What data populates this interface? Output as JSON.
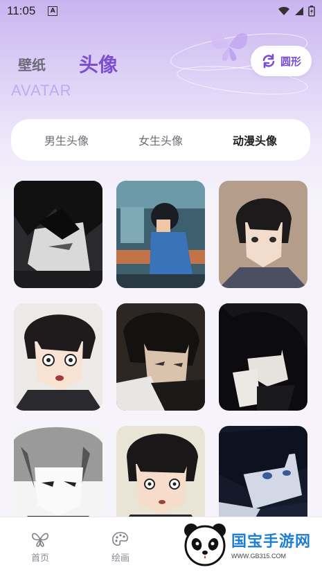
{
  "status_bar": {
    "time": "11:05",
    "notification_letter": "A"
  },
  "header": {
    "tab_wallpaper": "壁纸",
    "tab_avatar": "头像",
    "subtitle": "AVATAR",
    "shape_button_label": "圆形"
  },
  "categories": [
    {
      "label": "男生头像",
      "active": false
    },
    {
      "label": "女生头像",
      "active": false
    },
    {
      "label": "动漫头像",
      "active": true
    }
  ],
  "avatars": [
    {
      "icon": "anime-avatar-dark-glasses"
    },
    {
      "icon": "anime-avatar-boy-at-computer"
    },
    {
      "icon": "anime-avatar-boy-beige"
    },
    {
      "icon": "anime-avatar-surprised-boy"
    },
    {
      "icon": "anime-avatar-boy-smirk"
    },
    {
      "icon": "anime-avatar-dark-hand"
    },
    {
      "icon": "anime-avatar-white-hair"
    },
    {
      "icon": "anime-avatar-shocked-boy"
    },
    {
      "icon": "anime-avatar-lying-boy"
    }
  ],
  "bottom_nav": [
    {
      "label": "首页",
      "icon": "butterfly-icon"
    },
    {
      "label": "绘画",
      "icon": "palette-icon"
    }
  ],
  "watermark": {
    "title": "国宝手游网",
    "url": "WWW.GB315.COM"
  },
  "colors": {
    "accent": "#7b4fd0",
    "background": "#f6f4fa"
  }
}
